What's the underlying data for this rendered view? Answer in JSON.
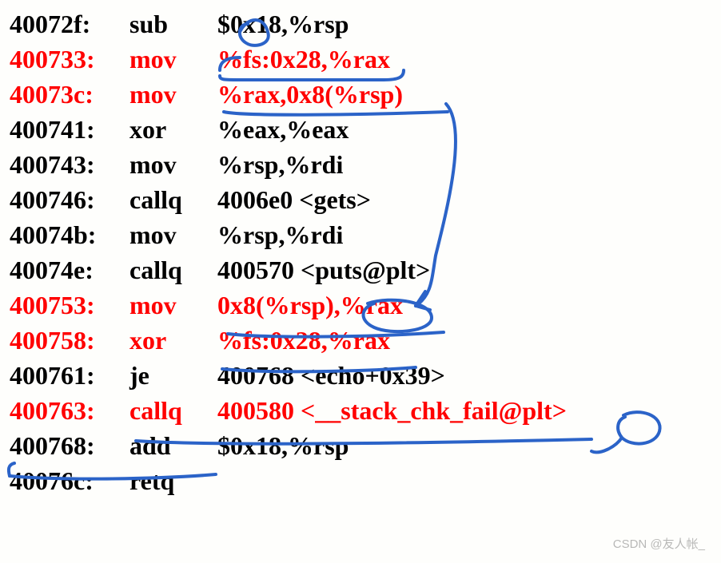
{
  "lines": [
    {
      "addr": "40072f:",
      "mn": "sub",
      "ops": "$0x18,%rsp",
      "color": "blk"
    },
    {
      "addr": "400733:",
      "mn": "mov",
      "ops": "%fs:0x28,%rax",
      "color": "red"
    },
    {
      "addr": "40073c:",
      "mn": "mov",
      "ops": "%rax,0x8(%rsp)",
      "color": "red"
    },
    {
      "addr": "400741:",
      "mn": "xor",
      "ops": "%eax,%eax",
      "color": "blk"
    },
    {
      "addr": "400743:",
      "mn": "mov",
      "ops": "%rsp,%rdi",
      "color": "blk"
    },
    {
      "addr": "400746:",
      "mn": "callq",
      "ops": "4006e0 <gets>",
      "color": "blk"
    },
    {
      "addr": "40074b:",
      "mn": "mov",
      "ops": "%rsp,%rdi",
      "color": "blk"
    },
    {
      "addr": "40074e:",
      "mn": "callq",
      "ops": "400570 <puts@plt>",
      "color": "blk"
    },
    {
      "addr": "400753:",
      "mn": "mov",
      "ops": "0x8(%rsp),%rax",
      "color": "red"
    },
    {
      "addr": "400758:",
      "mn": "xor",
      "ops": "%fs:0x28,%rax",
      "color": "red"
    },
    {
      "addr": "400761:",
      "mn": "je",
      "ops": "400768 <echo+0x39>",
      "color": "blk"
    },
    {
      "addr": "400763:",
      "mn": "callq",
      "ops": "400580 <__stack_chk_fail@plt>",
      "color": "red"
    },
    {
      "addr": "400768:",
      "mn": "add",
      "ops": "$0x18,%rsp",
      "color": "blk"
    },
    {
      "addr": "40076c:",
      "mn": "retq",
      "ops": "",
      "color": "blk"
    }
  ],
  "watermark": "CSDN @友人帐_"
}
